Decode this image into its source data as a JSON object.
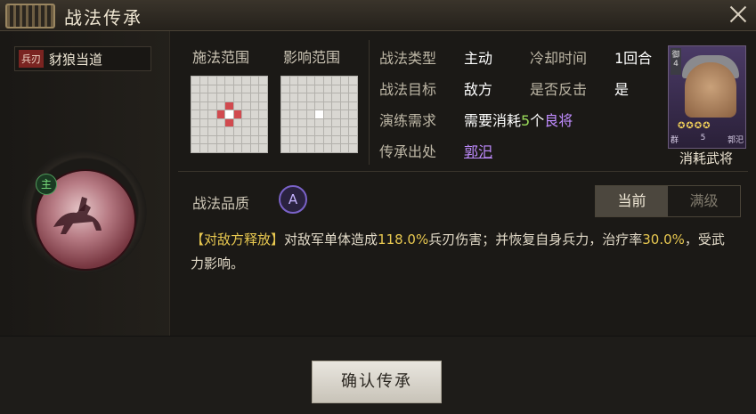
{
  "window": {
    "title": "战法传承"
  },
  "skill": {
    "type_tag": "兵刃",
    "name": "豺狼当道",
    "main_badge": "主"
  },
  "ranges": {
    "cast_label": "施法范围",
    "effect_label": "影响范围"
  },
  "info": {
    "type_label": "战法类型",
    "type_value": "主动",
    "cooldown_label": "冷却时间",
    "cooldown_value": "1回合",
    "target_label": "战法目标",
    "target_value": "敌方",
    "counter_label": "是否反击",
    "counter_value": "是",
    "require_label": "演练需求",
    "require_prefix": "需要消耗",
    "require_count": "5",
    "require_unit": "个",
    "require_item": "良将",
    "source_label": "传承出处",
    "source_value": "郭汜"
  },
  "card": {
    "flag": "御",
    "level": "4",
    "stars": "✪✪✪✪",
    "faction": "群",
    "cost": "5",
    "name": "郭汜",
    "caption": "消耗武将"
  },
  "quality": {
    "label": "战法品质",
    "grade": "A"
  },
  "toggle": {
    "current": "当前",
    "max": "满级",
    "selected": "current"
  },
  "description": {
    "tag": "【对敌方释放】",
    "part1": "对敌军单体造成",
    "damage": "118.0%",
    "part2": "兵刃伤害；并恢复自身兵力，治疗率",
    "heal": "30.0%",
    "part3": "，受武力影响。"
  },
  "footer": {
    "confirm_label": "确认传承"
  },
  "colors": {
    "accent_purple": "#c08cff",
    "highlight_yellow": "#e8c850",
    "number_green": "#9adb5a",
    "range_red": "#d14a4f"
  }
}
